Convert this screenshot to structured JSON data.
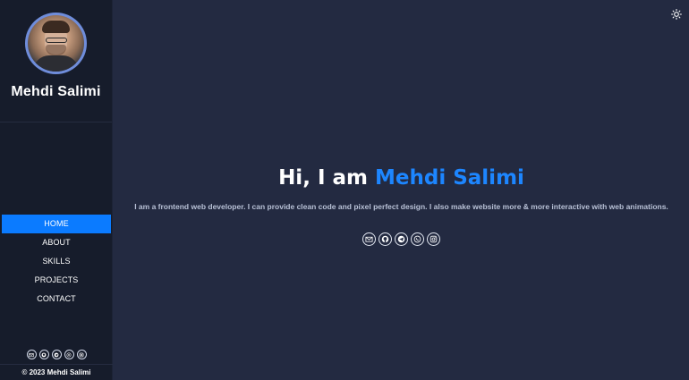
{
  "profile": {
    "name": "Mehdi Salimi"
  },
  "nav": {
    "items": [
      {
        "label": "HOME",
        "active": true
      },
      {
        "label": "ABOUT",
        "active": false
      },
      {
        "label": "SKILLS",
        "active": false
      },
      {
        "label": "PROJECTS",
        "active": false
      },
      {
        "label": "CONTACT",
        "active": false
      }
    ]
  },
  "social": {
    "icons": [
      "mail-icon",
      "github-icon",
      "telegram-icon",
      "whatsapp-icon",
      "instagram-icon"
    ]
  },
  "footer": {
    "copyright": "© 2023 Mehdi Salimi"
  },
  "hero": {
    "greeting": "Hi, I am ",
    "name": "Mehdi Salimi",
    "intro": "I am a frontend web developer. I can provide clean code and pixel perfect design. I also make website more & more interactive with web animations."
  },
  "theme": {
    "icon": "sun-icon"
  },
  "colors": {
    "accent": "#0b7bff",
    "background": "#232a41",
    "sidebar": "#161c2b",
    "avatar_ring": "#6f8ddb"
  }
}
